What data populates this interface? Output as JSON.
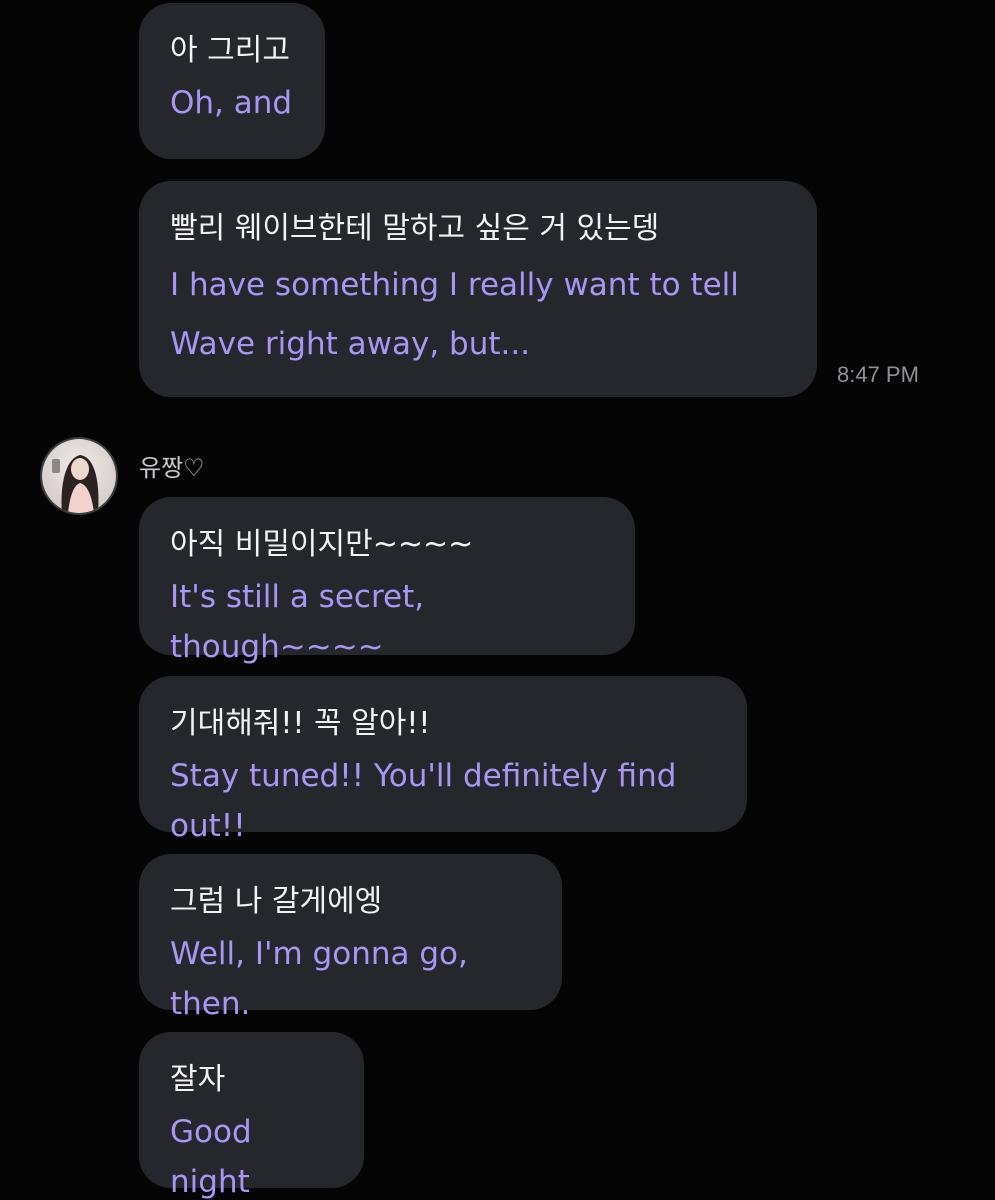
{
  "messages": [
    {
      "ko": "아 그리고",
      "en": "Oh, and"
    },
    {
      "ko": "빨리 웨이브한테 말하고 싶은 거 있는뎅",
      "en": "I have something I really want to tell\nWave right away, but..."
    },
    {
      "ko": "아직 비밀이지만~~~~",
      "en": "It's still a secret, though~~~~"
    },
    {
      "ko": "기대해줘!! 꼭 알아!!",
      "en": "Stay tuned!! You'll definitely find out!!"
    },
    {
      "ko": "그럼 나 갈게에엥",
      "en": "Well, I'm gonna go, then."
    },
    {
      "ko": "잘자",
      "en": "Good night"
    }
  ],
  "timestamp": "8:47 PM",
  "sender": {
    "name": "유짱♡"
  },
  "colors": {
    "background": "#050506",
    "bubble": "#25272d",
    "korean_text": "#f2f2f4",
    "translation_text": "#a996f4",
    "timestamp": "#8f9096"
  }
}
